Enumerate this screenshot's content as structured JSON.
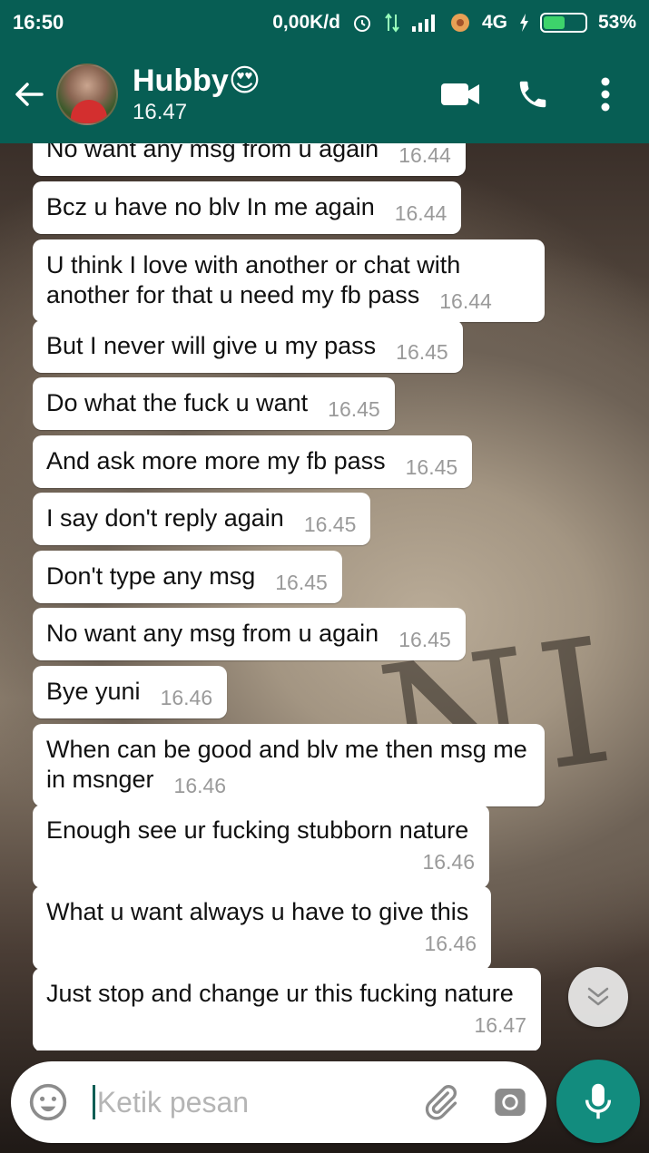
{
  "status_bar": {
    "time": "16:50",
    "network_speed": "0,00K/d",
    "network_type": "4G",
    "battery_percent": "53%",
    "battery_level": 0.53
  },
  "header": {
    "contact_name": "Hubby😍",
    "last_seen": "16.47",
    "icons": [
      "back-arrow-icon",
      "video-call-icon",
      "phone-icon",
      "more-options-icon"
    ]
  },
  "messages": [
    {
      "text": "No want any msg from u again",
      "time": "16.44"
    },
    {
      "text": "Bcz u have no blv In me again",
      "time": "16.44"
    },
    {
      "text": "U think I love with another or chat with another for that u need my fb pass",
      "time": "16.44"
    },
    {
      "text": "But I never will give u my pass",
      "time": "16.45"
    },
    {
      "text": "Do what the fuck u want",
      "time": "16.45"
    },
    {
      "text": "And ask more more my fb pass",
      "time": "16.45"
    },
    {
      "text": "I say don't reply again",
      "time": "16.45"
    },
    {
      "text": "Don't type any msg",
      "time": "16.45"
    },
    {
      "text": "No want any msg from u again",
      "time": "16.45"
    },
    {
      "text": "Bye yuni",
      "time": "16.46"
    },
    {
      "text": "When can be good and blv me then msg me in msnger",
      "time": "16.46"
    },
    {
      "text": "Enough see ur fucking stubborn nature",
      "time": "16.46"
    },
    {
      "text": "What u want always u have to give this",
      "time": "16.46"
    },
    {
      "text": "Just stop and change ur this fucking nature",
      "time": "16.47"
    }
  ],
  "composer": {
    "placeholder": "Ketik pesan",
    "value": ""
  },
  "colors": {
    "header": "#075e54",
    "mic_button": "#128c7e",
    "bubble": "#ffffff",
    "time_text": "#9a9a9a"
  }
}
